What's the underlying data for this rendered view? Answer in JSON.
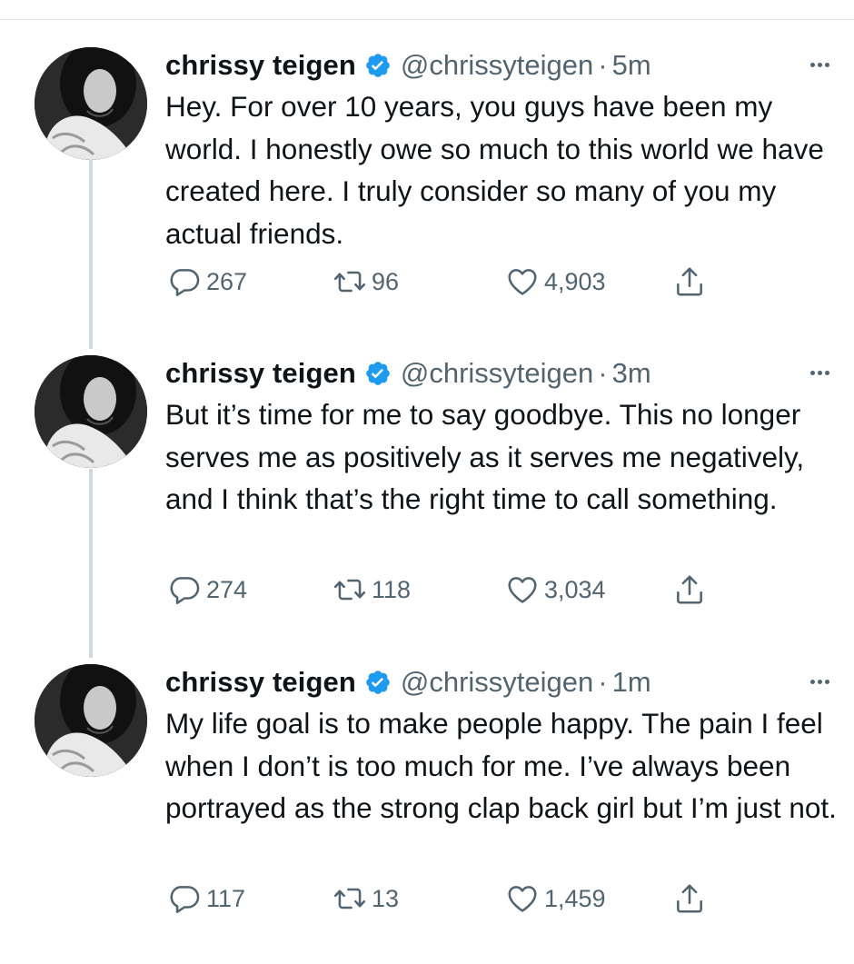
{
  "tweets": [
    {
      "name": "chrissy teigen",
      "handle": "@chrissyteigen",
      "separator": "·",
      "time": "5m",
      "text": "Hey. For over 10 years, you guys have been my world. I honestly owe so much to this world we have created here. I truly consider so many of you my actual friends.",
      "replies": "267",
      "retweets": "96",
      "likes": "4,903"
    },
    {
      "name": "chrissy teigen",
      "handle": "@chrissyteigen",
      "separator": "·",
      "time": "3m",
      "text": "But it’s time for me to say goodbye. This no longer serves me as positively as it serves me negatively, and I think that’s the right time to call something.",
      "replies": "274",
      "retweets": "118",
      "likes": "3,034"
    },
    {
      "name": "chrissy teigen",
      "handle": "@chrissyteigen",
      "separator": "·",
      "time": "1m",
      "text": "My life goal is to make people happy. The pain I feel when I don’t is too much for me. I’ve always been portrayed as the strong clap back girl but I’m just not.",
      "replies": "117",
      "retweets": "13",
      "likes": "1,459"
    }
  ],
  "colors": {
    "text": "#0f1419",
    "secondary": "#536471",
    "verified": "#1d9bf0",
    "thread_line": "#cfd9de"
  },
  "icons": {
    "verified": "verified-badge-icon",
    "more": "more-icon",
    "reply": "reply-icon",
    "retweet": "retweet-icon",
    "like": "like-icon",
    "share": "share-icon"
  }
}
